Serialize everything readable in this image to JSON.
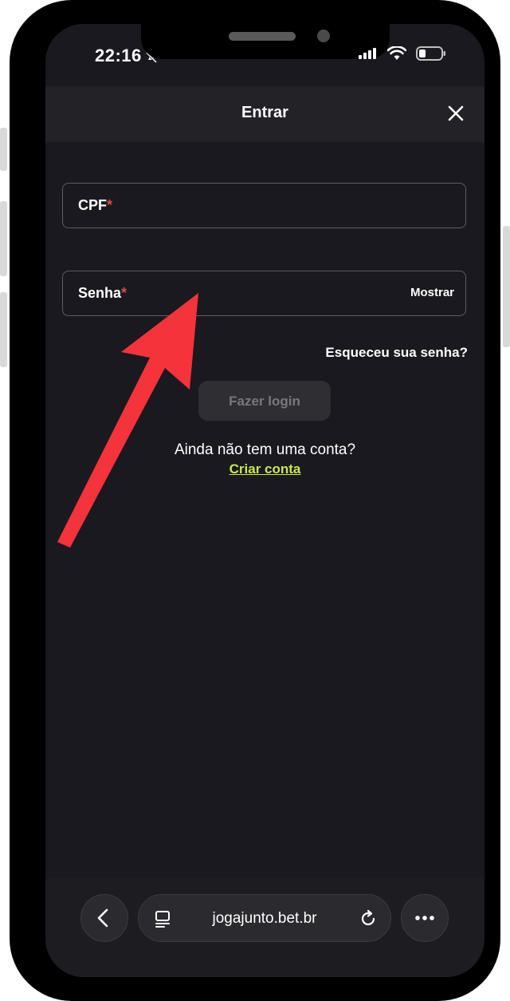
{
  "status_bar": {
    "time": "22:16"
  },
  "header": {
    "title": "Entrar"
  },
  "form": {
    "cpf_label": "CPF",
    "password_label": "Senha",
    "required_mark": "*",
    "show_label": "Mostrar",
    "forgot_label": "Esqueceu sua senha?",
    "login_label": "Fazer login",
    "no_account_text": "Ainda não tem uma conta?",
    "create_account_label": "Criar conta"
  },
  "browser": {
    "url": "jogajunto.bet.br"
  },
  "icons": {
    "close": "close-icon",
    "back": "chevron-left-icon",
    "tabs": "tabs-icon",
    "reload": "reload-icon",
    "more": "more-icon",
    "wifi": "wifi-icon",
    "battery": "battery-icon",
    "mute": "bell-slash-icon",
    "annotation": "arrow-annotation"
  },
  "colors": {
    "background": "#1a191f",
    "header": "#232327",
    "accent_link": "#c9e84a",
    "required": "#e04848",
    "annotation_arrow": "#f5333b",
    "disabled_button": "#2e2e33"
  }
}
